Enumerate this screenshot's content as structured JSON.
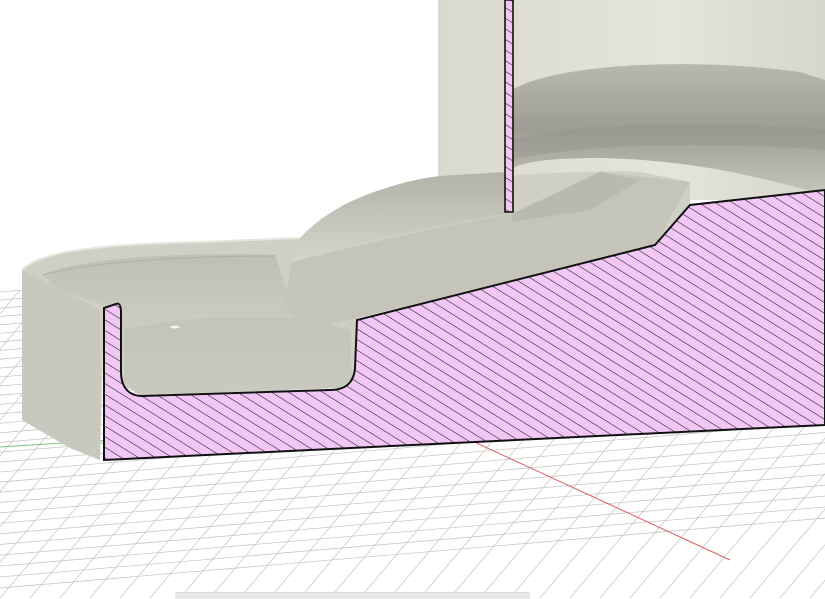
{
  "viewport": {
    "background_color": "#ffffff",
    "grid_color": "#c9c9c9",
    "x_axis_color": "#e06060",
    "y_axis_color": "#7cc47c",
    "body_color": "#cfcfc6",
    "section_fill_color": "#f2c6f5",
    "hatch_color": "#1a1a1a"
  }
}
